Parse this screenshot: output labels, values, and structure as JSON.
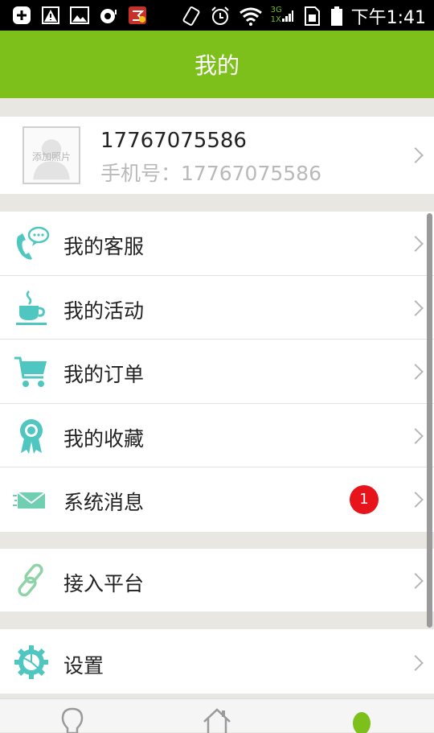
{
  "status_bar": {
    "time": "下午1:41",
    "network_label_top": "3G",
    "network_label_bottom": "1X",
    "icons": [
      "add-notification-icon",
      "warning-image-icon",
      "gallery-icon",
      "camera-icon",
      "app-icon",
      "rotate-icon",
      "alarm-icon",
      "wifi-icon",
      "signal-icon",
      "sim-icon",
      "battery-icon"
    ]
  },
  "header": {
    "title": "我的"
  },
  "profile": {
    "avatar_placeholder": "添加照片",
    "username": "17767075586",
    "phone_label": "手机号：",
    "phone_value": "17767075586"
  },
  "menu": {
    "items": [
      {
        "label": "我的客服",
        "icon": "customer-service-icon"
      },
      {
        "label": "我的活动",
        "icon": "coffee-cup-icon"
      },
      {
        "label": "我的订单",
        "icon": "shopping-cart-icon"
      },
      {
        "label": "我的收藏",
        "icon": "ribbon-award-icon"
      },
      {
        "label": "系统消息",
        "icon": "envelope-icon",
        "badge": "1"
      }
    ],
    "platform_item": {
      "label": "接入平台",
      "icon": "link-icon"
    },
    "settings_item": {
      "label": "设置",
      "icon": "gear-icon"
    }
  },
  "tabs": [
    {
      "name": "discover",
      "icon": "lightbulb-icon"
    },
    {
      "name": "home",
      "icon": "home-icon"
    },
    {
      "name": "mine",
      "icon": "profile-dot-icon",
      "active": true
    }
  ],
  "colors": {
    "accent": "#7dbf1b",
    "icon_teal": "#4fc6c0",
    "badge": "#e8141b"
  }
}
